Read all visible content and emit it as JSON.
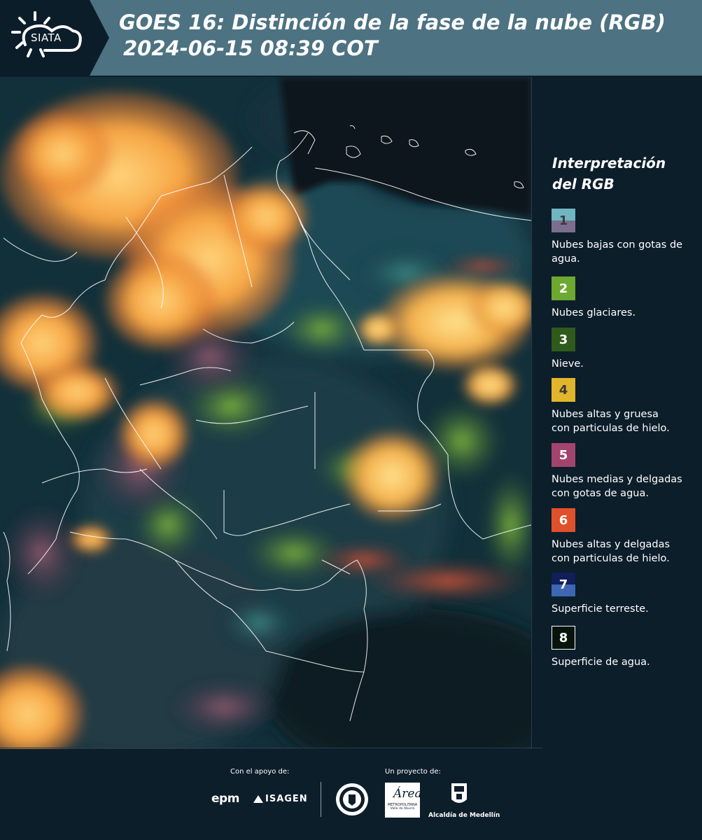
{
  "header": {
    "logo_text": "SIATA",
    "title_line1": "GOES 16: Distinción de la fase de la nube (RGB)",
    "title_line2": "2024-06-15 08:39 COT"
  },
  "legend": {
    "title_line1": "Interpretación",
    "title_line2": "del RGB",
    "items": [
      {
        "num": "1",
        "text_line1": "Nubes bajas con gotas de",
        "text_line2": "agua.",
        "color": "#6fb6c1",
        "color2": "#7c6f8e"
      },
      {
        "num": "2",
        "text_line1": "Nubes glaciares.",
        "text_line2": "",
        "color": "#6da830"
      },
      {
        "num": "3",
        "text_line1": "Nieve.",
        "text_line2": "",
        "color": "#2e5a1b"
      },
      {
        "num": "4",
        "text_line1": "Nubes altas y gruesa",
        "text_line2": "con particulas de hielo.",
        "color": "#e2b62b"
      },
      {
        "num": "5",
        "text_line1": "Nubes medias y delgadas",
        "text_line2": "con gotas de agua.",
        "color": "#a3446e"
      },
      {
        "num": "6",
        "text_line1": "Nubes altas y delgadas",
        "text_line2": "con particulas de hielo.",
        "color": "#e0502a"
      },
      {
        "num": "7",
        "text_line1": "Superficie terreste.",
        "text_line2": "",
        "color": "#101e5a",
        "color2": "#3e66b4"
      },
      {
        "num": "8",
        "text_line1": "Superficie de agua.",
        "text_line2": "",
        "color": "#06140c"
      }
    ]
  },
  "footer": {
    "support_label": "Con el apoyo de:",
    "project_label": "Un proyecto de:",
    "sponsor1": "epm",
    "sponsor2": "ISAGEN",
    "partner1": "METROPOLITANA",
    "partner1_sub": "Valle de Aburrá",
    "partner2": "Alcaldía de Medellín"
  }
}
